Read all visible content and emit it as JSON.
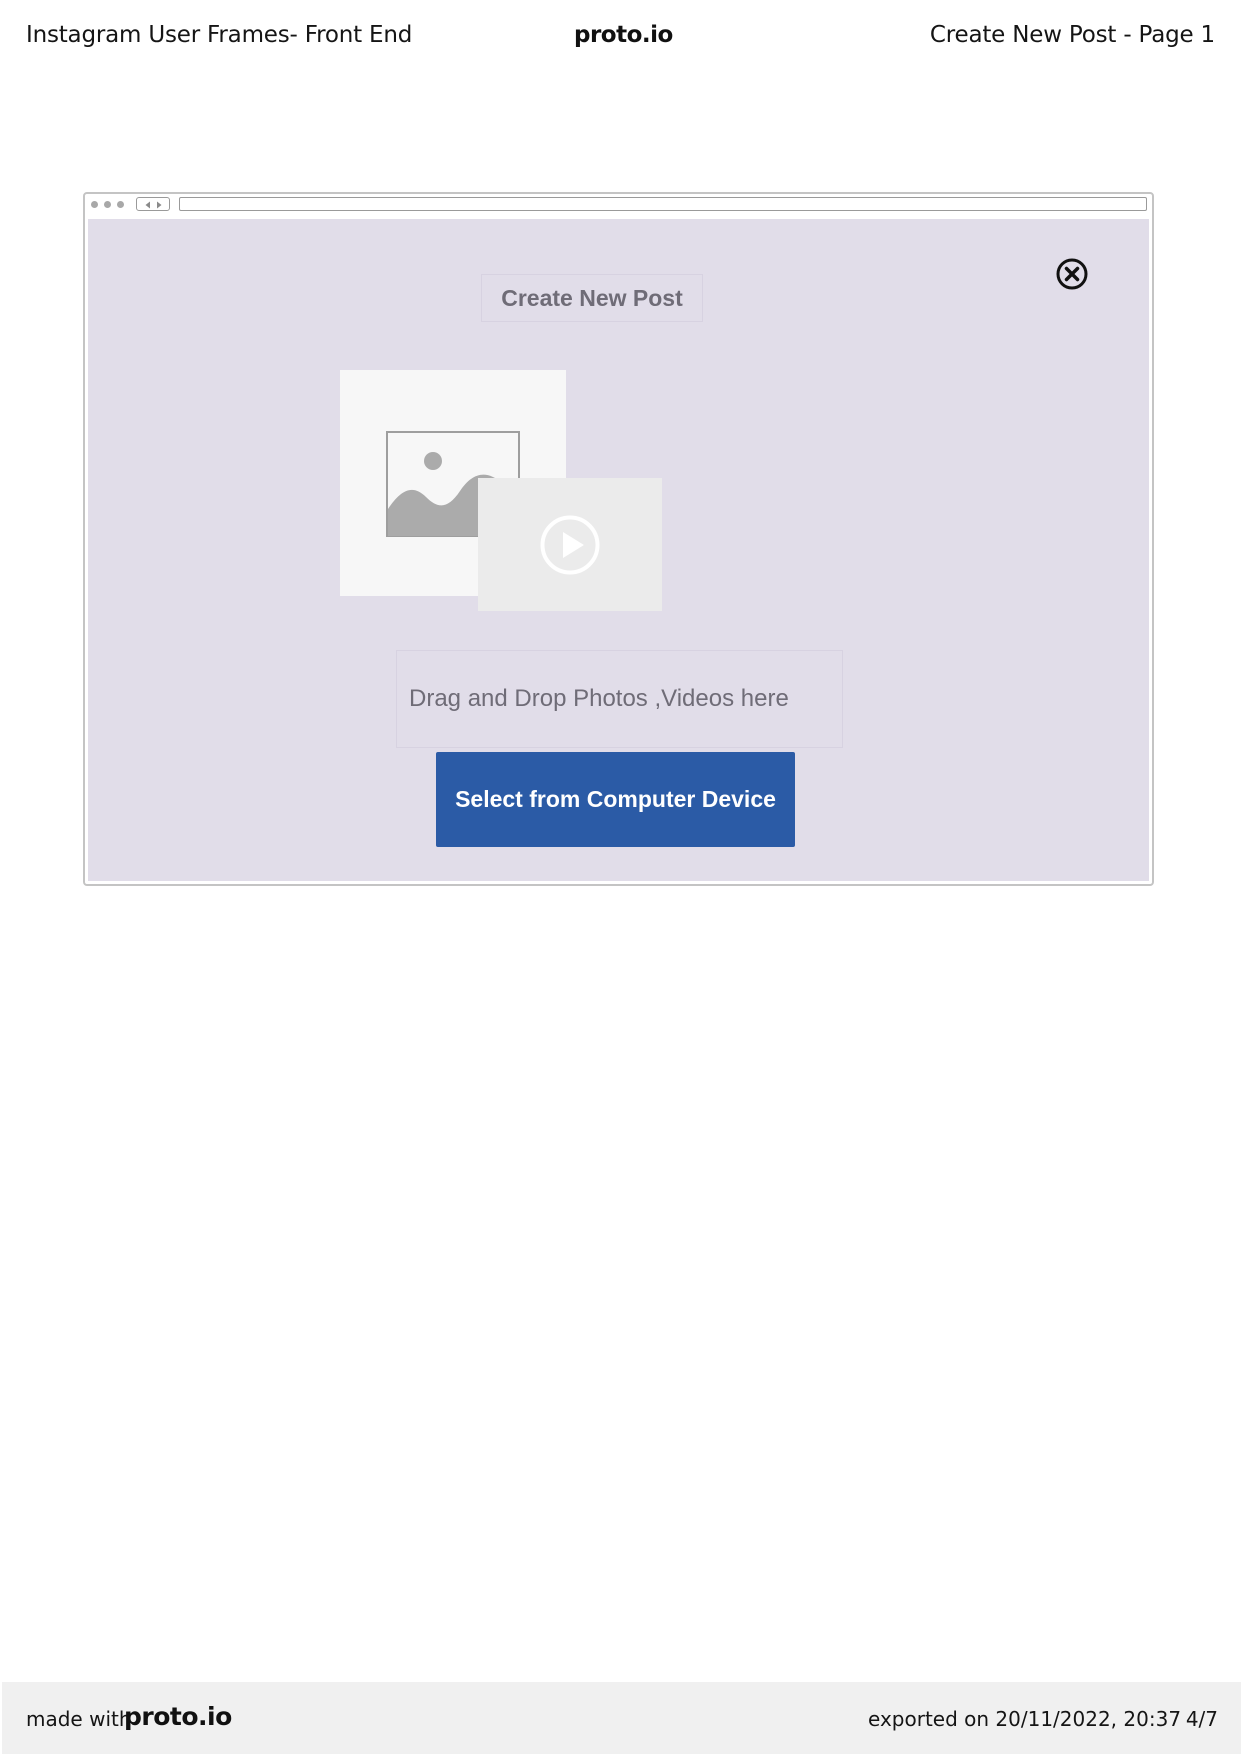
{
  "header": {
    "project_title": "Instagram User Frames- Front End",
    "logo_text": "proto.io",
    "page_title": "Create New Post - Page 1"
  },
  "browser": {
    "url": "",
    "nav_icons": [
      "back-arrow-icon",
      "forward-arrow-icon"
    ],
    "window_dots": 3
  },
  "dialog": {
    "title": "Create New Post",
    "close_icon": "close-circle-icon",
    "image_placeholder_icon": "image-placeholder-icon",
    "video_placeholder_icon": "play-circle-icon",
    "drop_text": "Drag and Drop Photos ,Videos here",
    "select_button_label": "Select from Computer Device"
  },
  "colors": {
    "viewport_background": "#e1dde9",
    "button_background": "#2b5ba6",
    "button_text": "#ffffff",
    "muted_text": "#6f6c77"
  },
  "footer": {
    "made_with": "made with",
    "logo_text": "proto.io",
    "exported": "exported on 20/11/2022, 20:37",
    "page_indicator": "4/7"
  }
}
